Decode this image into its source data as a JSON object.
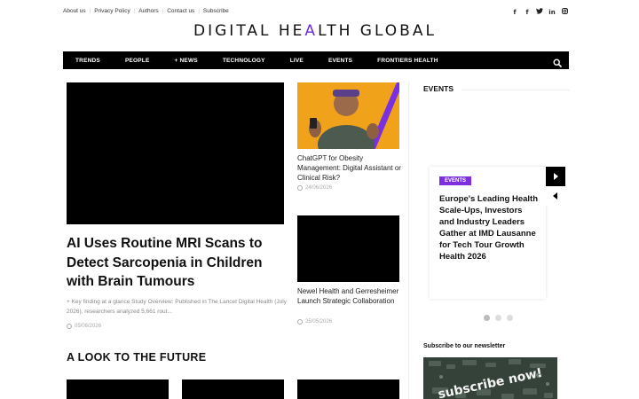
{
  "top_links": [
    "About us",
    "Privacy Policy",
    "Authors",
    "Contact us",
    "Subscribe"
  ],
  "social": {
    "items": [
      "f",
      "f",
      "t",
      "in",
      "ig"
    ],
    "icons": [
      "facebook-icon",
      "facebook-icon",
      "twitter-icon",
      "linkedin-icon",
      "instagram-icon"
    ]
  },
  "logo": {
    "part1": "DIGITAL HE",
    "accent": "A",
    "part2": "LTH GLOBAL",
    "accent_color": "#6a2ddb"
  },
  "nav": {
    "items": [
      "TRENDS",
      "PEOPLE",
      "+ NEWS",
      "TECHNOLOGY",
      "LIVE",
      "EVENTS",
      "FRONTIERS HEALTH"
    ],
    "search_icon": "search-icon"
  },
  "hero": {
    "title": "AI Uses Routine MRI Scans to Detect Sarcopenia in Children with Brain Tumours",
    "excerpt": "+ Key finding at a glance Study Overview: Published in The Lancet Digital Health (July 2026), researchers analyzed 5,661 rout...",
    "date": "05/08/2026"
  },
  "side_articles": [
    {
      "title": "ChatGPT for Obesity Management: Digital Assistant or Clinical Risk?",
      "date": "24/06/2026"
    },
    {
      "title": "Newel Health and Gerresheimer Launch Strategic Collaboration",
      "date": "25/05/2026"
    }
  ],
  "section": {
    "title": "A LOOK TO THE FUTURE"
  },
  "events": {
    "heading": "EVENTS",
    "badge": "EVENTS",
    "title": "Europe's Leading Health Scale-Ups, Investors and Industry Leaders Gather at IMD Lausanne for Tech Tour Growth Health 2026",
    "badge_color": "#7b2fe0"
  },
  "newsletter": {
    "heading": "Subscribe to our newsletter",
    "image_text": "subscribe now!"
  }
}
